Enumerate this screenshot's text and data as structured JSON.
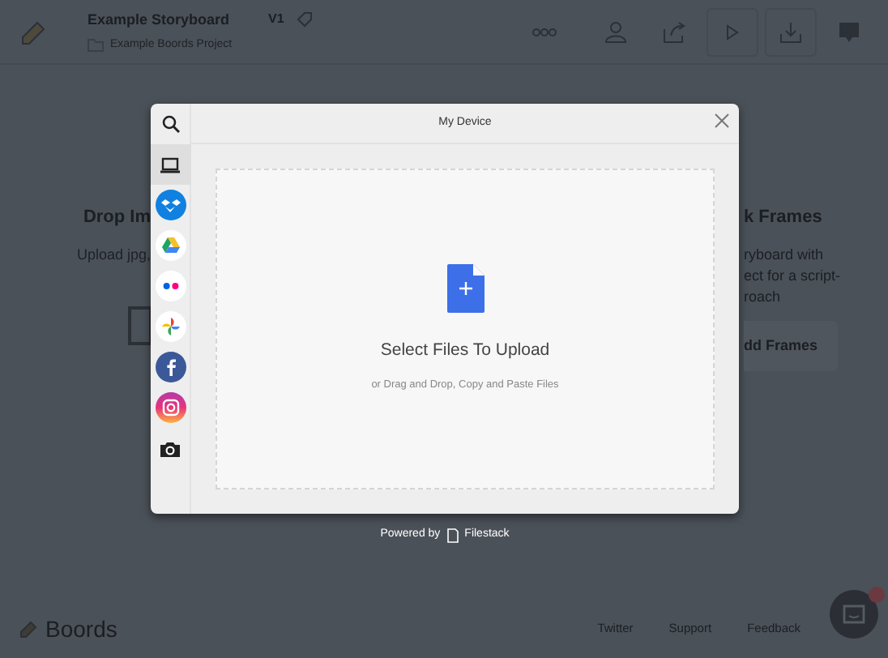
{
  "header": {
    "title": "Example Storyboard",
    "version": "V1",
    "project": "Example Boords Project"
  },
  "left_panel": {
    "heading": "Drop Im",
    "text": "Upload jpg,"
  },
  "right_panel": {
    "heading": "k Frames",
    "lines": [
      "ryboard with",
      "ect for a script-",
      "roach"
    ],
    "button": "dd Frames"
  },
  "modal": {
    "title": "My Device",
    "sources": [
      {
        "kind": "device",
        "selected": true
      },
      {
        "kind": "dropbox",
        "selected": false
      },
      {
        "kind": "drive",
        "selected": false
      },
      {
        "kind": "flickr",
        "selected": false
      },
      {
        "kind": "photos",
        "selected": false
      },
      {
        "kind": "facebook",
        "selected": false
      },
      {
        "kind": "instagram",
        "selected": false
      },
      {
        "kind": "camera",
        "selected": false
      }
    ],
    "dropzone": {
      "title": "Select Files To Upload",
      "subtitle": "or Drag and Drop, Copy and Paste Files"
    }
  },
  "powered_by": {
    "prefix": "Powered by",
    "brand": "Filestack"
  },
  "footer": {
    "logo": "Boords",
    "links": [
      "Twitter",
      "Support",
      "Feedback"
    ]
  }
}
